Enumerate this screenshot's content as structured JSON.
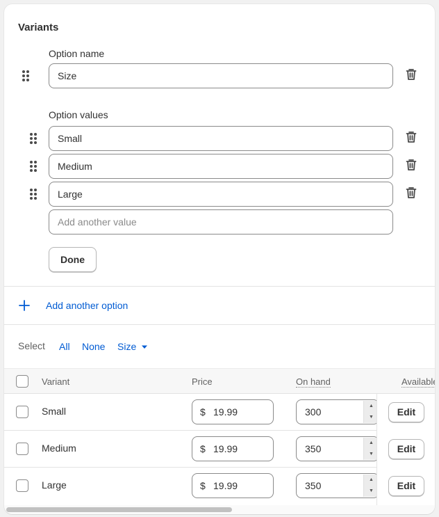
{
  "section": {
    "title": "Variants"
  },
  "option": {
    "name_label": "Option name",
    "name_value": "Size",
    "values_label": "Option values",
    "values": [
      "Small",
      "Medium",
      "Large"
    ],
    "add_value_placeholder": "Add another value",
    "done_label": "Done"
  },
  "add_option": {
    "label": "Add another option"
  },
  "select_bar": {
    "label": "Select",
    "all": "All",
    "none": "None",
    "filter": "Size"
  },
  "table": {
    "headers": {
      "variant": "Variant",
      "price": "Price",
      "on_hand": "On hand",
      "available": "Available"
    },
    "rows": [
      {
        "variant": "Small",
        "currency": "$",
        "price": "19.99",
        "on_hand": "300",
        "action": "Edit"
      },
      {
        "variant": "Medium",
        "currency": "$",
        "price": "19.99",
        "on_hand": "350",
        "action": "Edit"
      },
      {
        "variant": "Large",
        "currency": "$",
        "price": "19.99",
        "on_hand": "350",
        "action": "Edit"
      }
    ]
  },
  "icons": {
    "drag": "drag-handle-icon",
    "delete": "trash-icon",
    "add": "plus-icon",
    "caret": "caret-down-icon"
  },
  "colors": {
    "link": "#005bd3",
    "text": "#303030",
    "border": "#8a8a8a"
  }
}
